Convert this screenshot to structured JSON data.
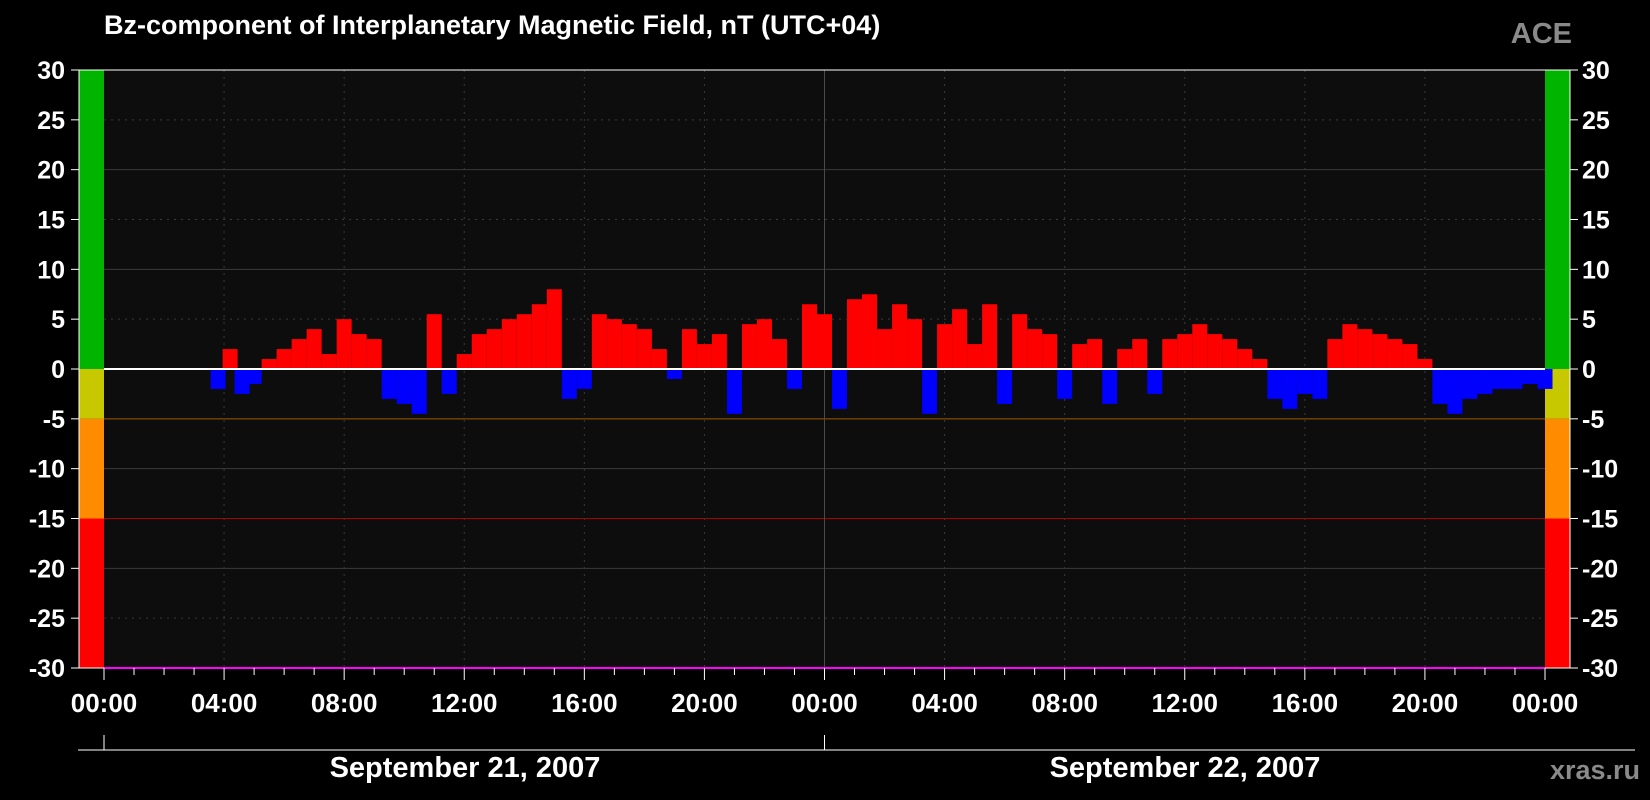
{
  "title": "Bz-component of Interplanetary Magnetic Field, nT (UTC+04)",
  "source_label": "ACE",
  "credit": "xras.ru",
  "colors": {
    "background": "#000000",
    "plot_background": "#0d0d0d",
    "positive": "#ff0000",
    "negative": "#0000ff",
    "band_green": "#00b400",
    "band_yellow": "#c8c800",
    "band_orange": "#ff8c00",
    "band_red": "#ff0000",
    "line_orange": "#a05a00",
    "line_red": "#aa0000"
  },
  "chart_data": {
    "type": "bar",
    "title": "Bz-component of Interplanetary Magnetic Field, nT (UTC+04)",
    "ylabel": "",
    "xlabel": "",
    "ylim": [
      -30,
      30
    ],
    "xlim_hours": [
      0,
      48
    ],
    "y_ticks": [
      "30",
      "25",
      "20",
      "15",
      "10",
      "5",
      "0",
      "-5",
      "-10",
      "-15",
      "-20",
      "-25",
      "-30"
    ],
    "x_tick_labels": [
      "00:00",
      "04:00",
      "08:00",
      "12:00",
      "16:00",
      "20:00",
      "00:00",
      "04:00",
      "08:00",
      "12:00",
      "16:00",
      "20:00",
      "00:00"
    ],
    "dates": [
      "September 21, 2007",
      "September 22, 2007"
    ],
    "threshold_bands": [
      {
        "from": 0,
        "to": 30,
        "color": "#00b400"
      },
      {
        "from": -5,
        "to": 0,
        "color": "#c8c800"
      },
      {
        "from": -15,
        "to": -5,
        "color": "#ff8c00"
      },
      {
        "from": -30,
        "to": -15,
        "color": "#ff0000"
      }
    ],
    "x_unit": "hours since 2007-09-21 00:00",
    "series": [
      {
        "x": [
          3.8,
          4.2,
          4.6,
          5.0,
          5.5,
          6.0,
          6.5,
          7.0,
          7.5,
          8.0,
          8.5,
          9.0,
          9.5,
          10.0,
          10.5,
          11.0,
          11.5,
          12.0,
          12.5,
          13.0,
          13.5,
          14.0,
          14.5,
          15.0,
          15.5,
          16.0,
          16.5,
          17.0,
          17.5,
          18.0,
          18.5,
          19.0,
          19.5,
          20.0,
          20.5,
          21.0,
          21.5,
          22.0,
          22.5,
          23.0,
          23.5,
          24.0,
          24.5,
          25.0,
          25.5,
          26.0,
          26.5,
          27.0,
          27.5,
          28.0,
          28.5,
          29.0,
          29.5,
          30.0,
          30.5,
          31.0,
          31.5,
          32.0,
          32.5,
          33.0,
          33.5,
          34.0,
          34.5,
          35.0,
          35.5,
          36.0,
          36.5,
          37.0,
          37.5,
          38.0,
          38.5,
          39.0,
          39.5,
          40.0,
          40.5,
          41.0,
          41.5,
          42.0,
          42.5,
          43.0,
          43.5,
          44.0,
          44.5,
          45.0,
          45.5,
          46.0,
          46.5,
          47.0,
          47.5,
          48.0
        ],
        "y": [
          -2.0,
          2.0,
          -2.5,
          -1.5,
          1.0,
          2.0,
          3.0,
          4.0,
          1.5,
          5.0,
          3.5,
          3.0,
          -3.0,
          -3.5,
          -4.5,
          5.5,
          -2.5,
          1.5,
          3.5,
          4.0,
          5.0,
          5.5,
          6.5,
          8.0,
          -3.0,
          -2.0,
          5.5,
          5.0,
          4.5,
          4.0,
          2.0,
          -1.0,
          4.0,
          2.5,
          3.5,
          -4.5,
          4.5,
          5.0,
          3.0,
          -2.0,
          6.5,
          5.5,
          -4.0,
          7.0,
          7.5,
          4.0,
          6.5,
          5.0,
          -4.5,
          4.5,
          6.0,
          2.5,
          6.5,
          -3.5,
          5.5,
          4.0,
          3.5,
          -3.0,
          2.5,
          3.0,
          -3.5,
          2.0,
          3.0,
          -2.5,
          3.0,
          3.5,
          4.5,
          3.5,
          3.0,
          2.0,
          1.0,
          -3.0,
          -4.0,
          -2.5,
          -3.0,
          3.0,
          4.5,
          4.0,
          3.5,
          3.0,
          2.5,
          1.0,
          -3.5,
          -4.5,
          -3.0,
          -2.5,
          -2.0,
          -2.0,
          -1.5,
          -2.0
        ]
      }
    ]
  }
}
